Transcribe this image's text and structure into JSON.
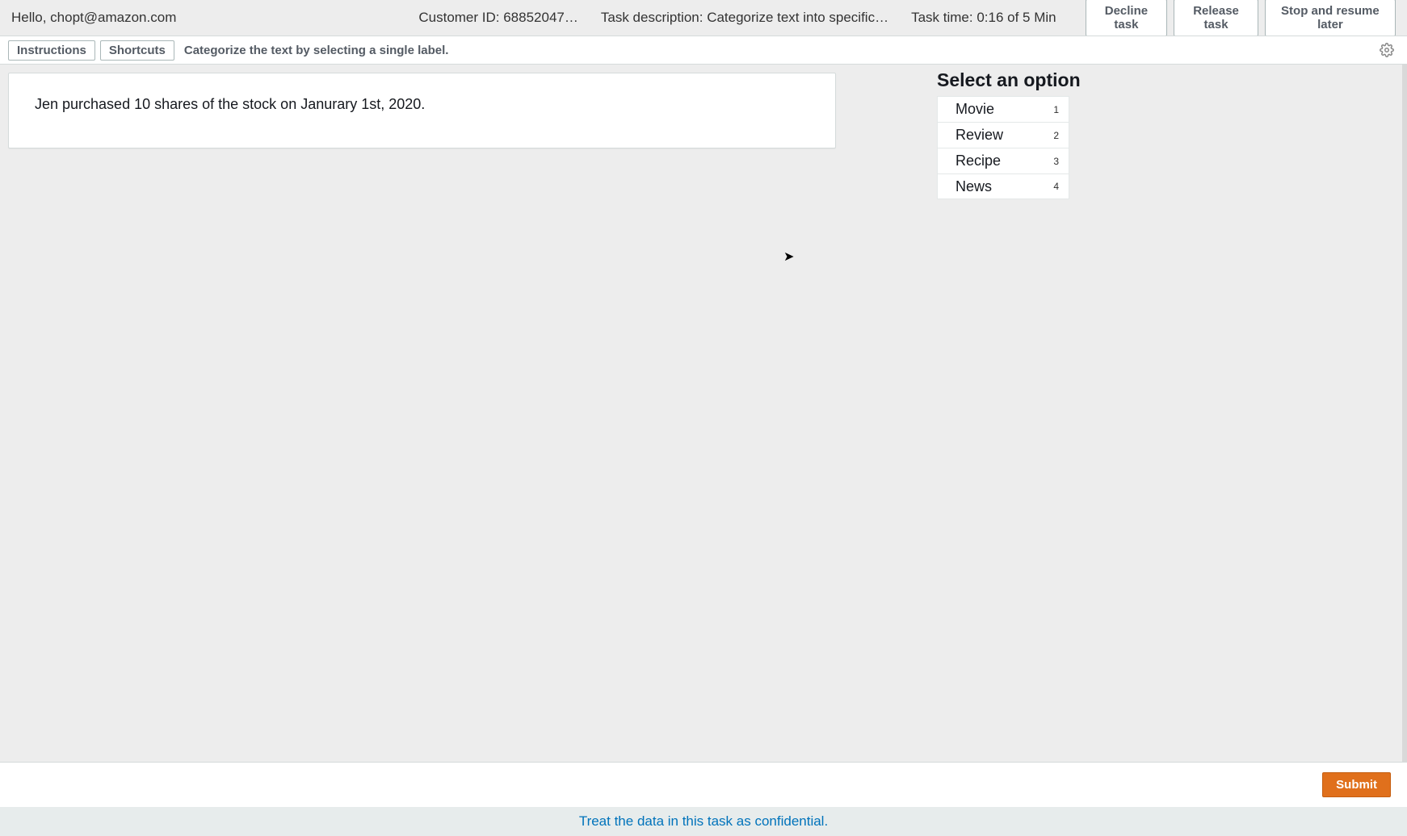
{
  "header": {
    "greeting": "Hello, chopt@amazon.com",
    "customer_id": "Customer ID: 68852047…",
    "task_description": "Task description: Categorize text into specific…",
    "task_time": "Task time: 0:16 of 5 Min",
    "buttons": {
      "decline": "Decline task",
      "release": "Release task",
      "stop_resume": "Stop and resume later"
    }
  },
  "subbar": {
    "instructions_btn": "Instructions",
    "shortcuts_btn": "Shortcuts",
    "instruction_text": "Categorize the text by selecting a single label."
  },
  "card": {
    "text": "Jen purchased 10 shares of the stock on Janurary 1st, 2020."
  },
  "options": {
    "title": "Select an option",
    "items": [
      {
        "label": "Movie",
        "shortcut": "1"
      },
      {
        "label": "Review",
        "shortcut": "2"
      },
      {
        "label": "Recipe",
        "shortcut": "3"
      },
      {
        "label": "News",
        "shortcut": "4"
      }
    ]
  },
  "footer": {
    "submit": "Submit",
    "confidential": "Treat the data in this task as confidential."
  }
}
